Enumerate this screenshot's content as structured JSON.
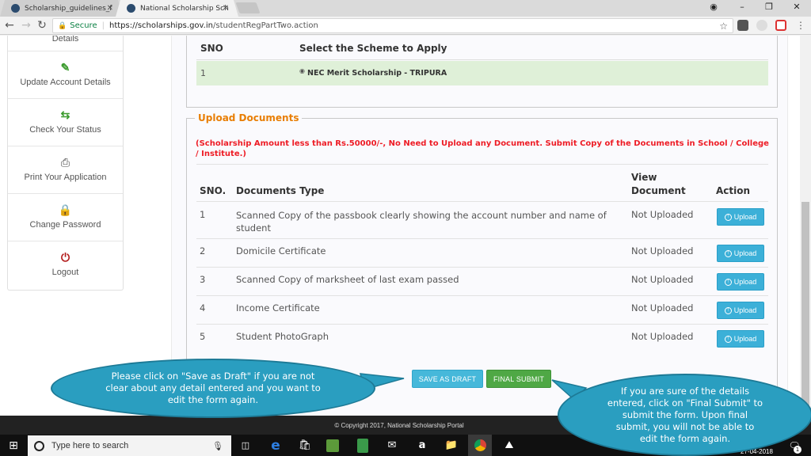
{
  "browser": {
    "tabs": [
      {
        "label": "Scholarship_guidelines_f",
        "active": false
      },
      {
        "label": "National Scholarship Sch",
        "active": true
      }
    ],
    "address": {
      "secure_label": "Secure",
      "url_host": "https://scholarships.gov.in",
      "url_path": "/studentRegPartTwo.action"
    }
  },
  "sidebar": {
    "items": [
      {
        "label": "Details",
        "icon": "details-icon"
      },
      {
        "label": "Update Account Details",
        "icon": "edit-icon"
      },
      {
        "label": "Check Your Status",
        "icon": "exchange-icon"
      },
      {
        "label": "Print Your Application",
        "icon": "print-icon"
      },
      {
        "label": "Change Password",
        "icon": "lock-icon"
      },
      {
        "label": "Logout",
        "icon": "power-icon"
      }
    ]
  },
  "scheme": {
    "headers": {
      "sno": "SNO",
      "scheme": "Select the Scheme to Apply"
    },
    "rows": [
      {
        "sno": "1",
        "scheme": "NEC Merit Scholarship - TRIPURA",
        "selected": true
      }
    ]
  },
  "upload": {
    "legend": "Upload Documents",
    "note": "(Scholarship Amount less than Rs.50000/-, No Need to Upload any Document. Submit Copy of the Documents in School / College / Institute.)",
    "headers": {
      "sno": "SNO.",
      "doc_type": "Documents Type",
      "view_line1": "View",
      "view_line2": "Document",
      "action": "Action"
    },
    "rows": [
      {
        "sno": "1",
        "doc_type": "Scanned Copy of the passbook clearly showing the account number and name of student",
        "status": "Not Uploaded",
        "action": "Upload"
      },
      {
        "sno": "2",
        "doc_type": "Domicile Certificate",
        "status": "Not Uploaded",
        "action": "Upload"
      },
      {
        "sno": "3",
        "doc_type": "Scanned Copy of marksheet of last exam passed",
        "status": "Not Uploaded",
        "action": "Upload"
      },
      {
        "sno": "4",
        "doc_type": "Income Certificate",
        "status": "Not Uploaded",
        "action": "Upload"
      },
      {
        "sno": "5",
        "doc_type": "Student PhotoGraph",
        "status": "Not Uploaded",
        "action": "Upload"
      }
    ],
    "save_draft_label": "SAVE AS DRAFT",
    "final_submit_label": "FINAL SUBMIT"
  },
  "footer": {
    "copyright": "© Copyright 2017, National Scholarship Portal"
  },
  "callouts": {
    "left": "Please click on \"Save as Draft\" if you are not clear about any detail entered and you want to edit the form again.",
    "right": "If you are sure of the details entered, click on \"Final Submit\" to submit the form. Upon final submit, you will not be able to edit the form again."
  },
  "taskbar": {
    "search_placeholder": "Type here to search",
    "date": "27-04-2018",
    "notification_count": "1"
  },
  "colors": {
    "accent_orange": "#e87e04",
    "note_red": "#ee1c25",
    "info_blue": "#3cb0d8",
    "success_green": "#4fa845",
    "callout_teal": "#2a9ec0",
    "selected_row": "#dff0d8"
  }
}
